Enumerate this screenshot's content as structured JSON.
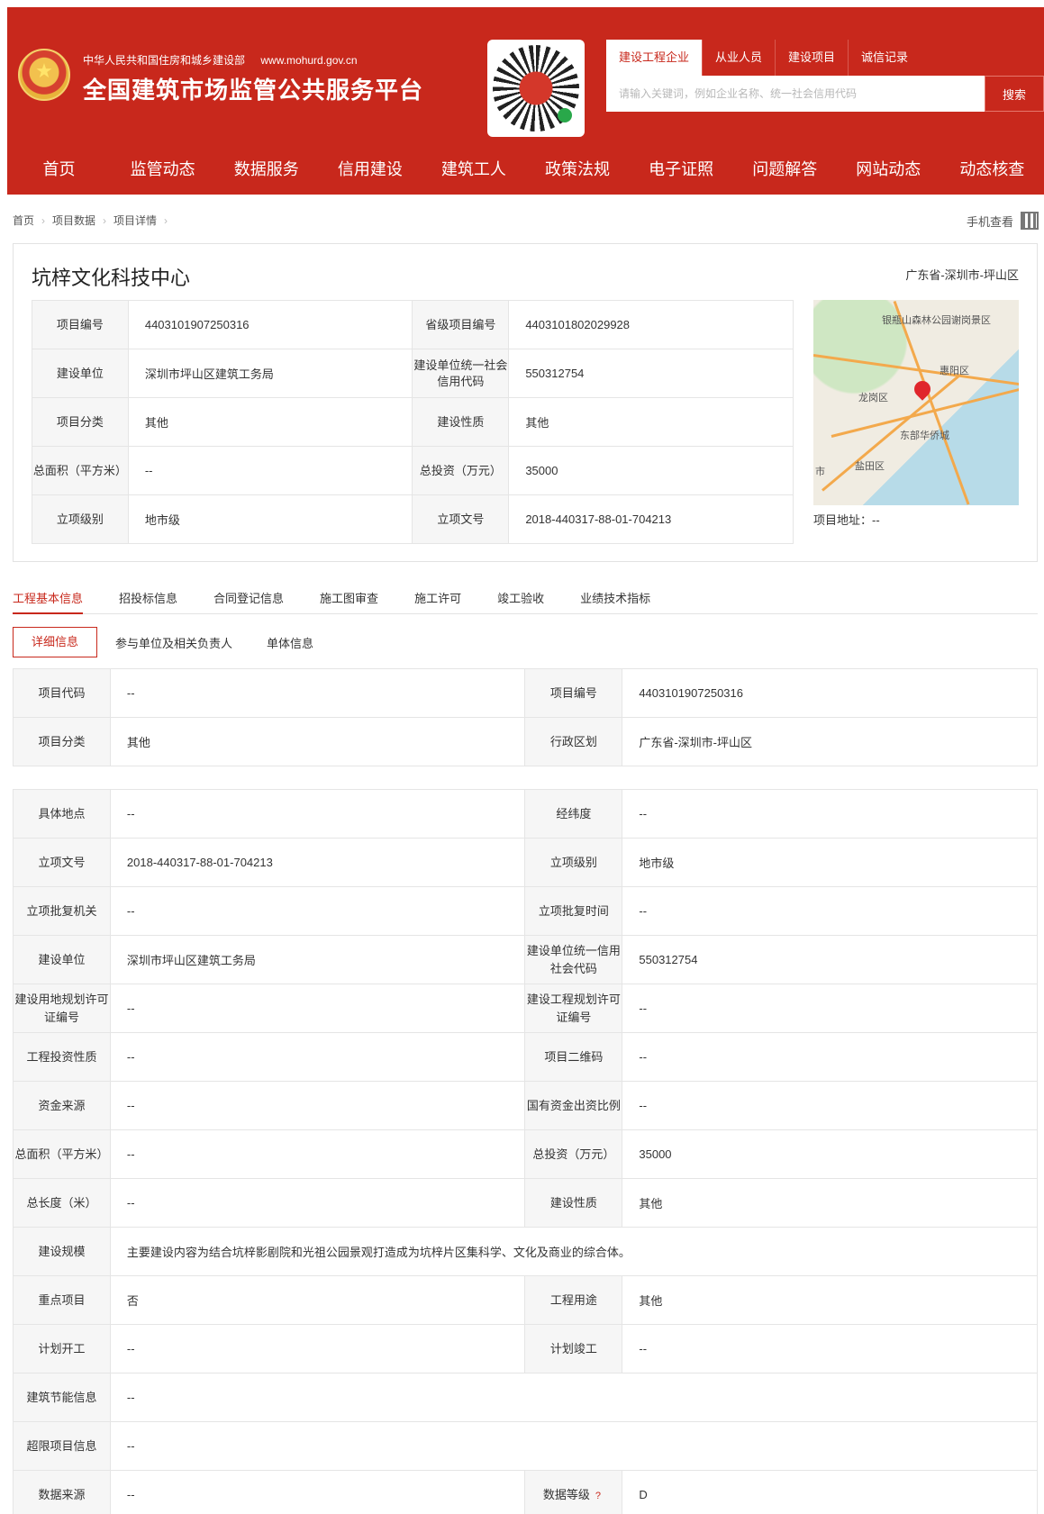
{
  "header": {
    "ministry": "中华人民共和国住房和城乡建设部",
    "url": "www.mohurd.gov.cn",
    "platform_name": "全国建筑市场监管公共服务平台"
  },
  "search": {
    "tabs": [
      "建设工程企业",
      "从业人员",
      "建设项目",
      "诚信记录"
    ],
    "placeholder": "请输入关键词，例如企业名称、统一社会信用代码",
    "button": "搜索"
  },
  "nav": [
    "首页",
    "监管动态",
    "数据服务",
    "信用建设",
    "建筑工人",
    "政策法规",
    "电子证照",
    "问题解答",
    "网站动态",
    "动态核查"
  ],
  "breadcrumb": [
    "首页",
    "项目数据",
    "项目详情"
  ],
  "mobile_view": "手机查看",
  "project": {
    "name": "坑梓文化科技中心",
    "region": "广东省-深圳市-坪山区",
    "info": [
      [
        "项目编号",
        "4403101907250316",
        "省级项目编号",
        "4403101802029928"
      ],
      [
        "建设单位",
        "深圳市坪山区建筑工务局",
        "建设单位统一社会信用代码",
        "550312754"
      ],
      [
        "项目分类",
        "其他",
        "建设性质",
        "其他"
      ],
      [
        "总面积（平方米）",
        "--",
        "总投资（万元）",
        "35000"
      ],
      [
        "立项级别",
        "地市级",
        "立项文号",
        "2018-440317-88-01-704213"
      ]
    ],
    "map": {
      "labels": [
        "银瓶山森林公园谢岗景区",
        "惠阳区",
        "龙岗区",
        "东部华侨城",
        "盐田区",
        "市"
      ],
      "address_label": "项目地址：",
      "address_value": "--"
    }
  },
  "tabs": [
    "工程基本信息",
    "招投标信息",
    "合同登记信息",
    "施工图审查",
    "施工许可",
    "竣工验收",
    "业绩技术指标"
  ],
  "subtabs": [
    "详细信息",
    "参与单位及相关负责人",
    "单体信息"
  ],
  "detail_top": [
    [
      "项目代码",
      "--",
      "项目编号",
      "4403101907250316"
    ],
    [
      "项目分类",
      "其他",
      "行政区划",
      "广东省-深圳市-坪山区"
    ]
  ],
  "detail_main": [
    [
      "具体地点",
      "--",
      "经纬度",
      "--"
    ],
    [
      "立项文号",
      "2018-440317-88-01-704213",
      "立项级别",
      "地市级"
    ],
    [
      "立项批复机关",
      "--",
      "立项批复时间",
      "--"
    ],
    [
      "建设单位",
      "深圳市坪山区建筑工务局",
      "建设单位统一信用社会代码",
      "550312754"
    ],
    [
      "建设用地规划许可证编号",
      "--",
      "建设工程规划许可证编号",
      "--"
    ],
    [
      "工程投资性质",
      "--",
      "项目二维码",
      "--"
    ],
    [
      "资金来源",
      "--",
      "国有资金出资比例",
      "--"
    ],
    [
      "总面积（平方米）",
      "--",
      "总投资（万元）",
      "35000"
    ],
    [
      "总长度（米）",
      "--",
      "建设性质",
      "其他"
    ],
    [
      "建设规模",
      "主要建设内容为结合坑梓影剧院和光祖公园景观打造成为坑梓片区集科学、文化及商业的综合体。"
    ],
    [
      "重点项目",
      "否",
      "工程用途",
      "其他"
    ],
    [
      "计划开工",
      "--",
      "计划竣工",
      "--"
    ],
    [
      "建筑节能信息",
      "--"
    ],
    [
      "超限项目信息",
      "--"
    ],
    [
      "数据来源",
      "--",
      "数据等级",
      "D"
    ]
  ],
  "help_mark": "?",
  "colors": {
    "brand": "#c8281c"
  }
}
